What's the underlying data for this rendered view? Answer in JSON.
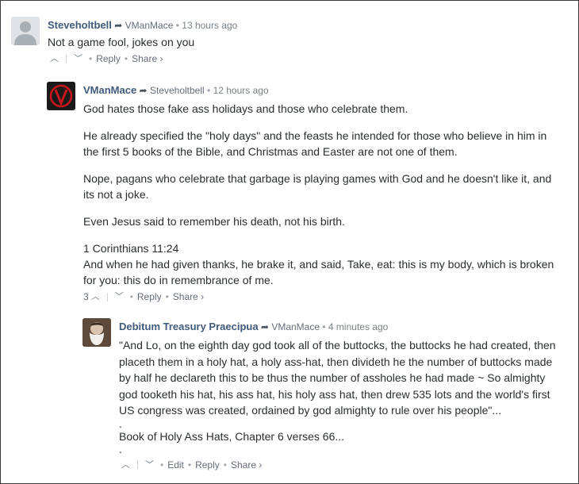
{
  "comments": [
    {
      "author": "Steveholtbell",
      "reply_to": "VManMace",
      "time": "13 hours ago",
      "paragraphs": [
        "Not a game fool, jokes on you"
      ],
      "actions": {
        "count": "",
        "reply": "Reply",
        "share": "Share ›"
      }
    },
    {
      "author": "VManMace",
      "reply_to": "Steveholtbell",
      "time": "12 hours ago",
      "paragraphs": [
        "God hates those fake ass holidays and those who celebrate them.",
        "He already specified the \"holy days\" and the feasts he intended for those who believe in him in the first 5 books of the Bible, and Christmas and Easter are not one of them.",
        "Nope, pagans who celebrate that garbage is playing games with God and he doesn't like it, and its not a joke.",
        "Even Jesus said to remember his death, not his birth.",
        "1 Corinthians 11:24",
        "And when he had given thanks, he brake it, and said, Take, eat: this is my body, which is broken for you: this do in remembrance of me."
      ],
      "actions": {
        "count": "3",
        "reply": "Reply",
        "share": "Share ›"
      }
    },
    {
      "author": "Debitum Treasury Praecipua",
      "reply_to": "VManMace",
      "time": "4 minutes ago",
      "paragraphs": [
        "\"And Lo, on the eighth day god took all of the buttocks, the buttocks he had created, then placeth them in a holy hat, a holy ass-hat, then divideth he the number of buttocks made by half he declareth this to be thus the number of assholes he had made ~ So almighty god tooketh his hat, his ass hat, his holy ass hat, then drew 535 lots and the world's first US congress was created, ordained by god almighty to rule over his people\"...",
        ".",
        "Book of Holy Ass Hats, Chapter 6 verses 66...",
        "."
      ],
      "actions": {
        "edit": "Edit",
        "reply": "Reply",
        "share": "Share ›"
      }
    }
  ],
  "colors": {
    "author": "#3f5a7a",
    "text": "#2a2e2e",
    "meta": "#7a8288",
    "vmanmace_avatar_bg": "#1a1a1a",
    "vmanmace_avatar_mark": "#c8161d"
  }
}
